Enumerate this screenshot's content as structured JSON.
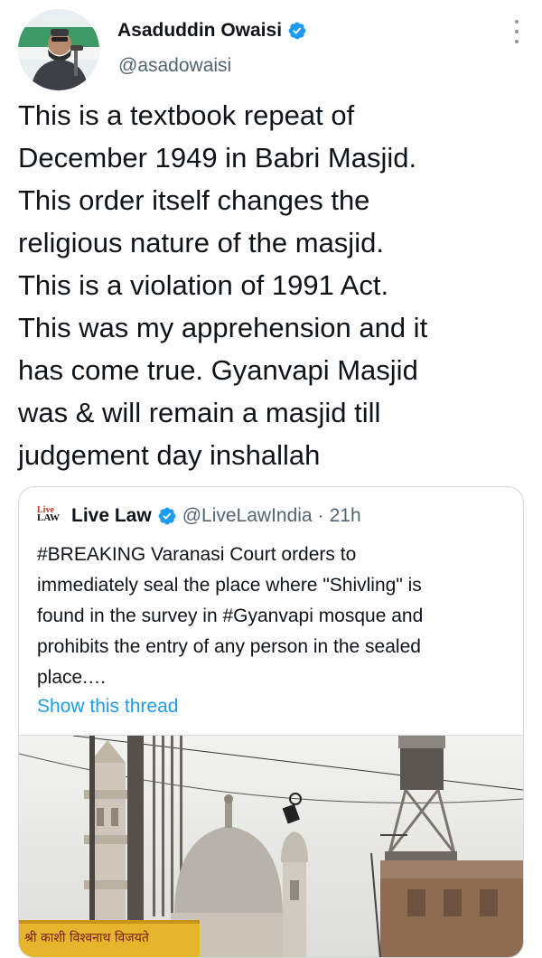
{
  "author": {
    "name": "Asaduddin Owaisi",
    "handle": "@asadowaisi",
    "verified": true,
    "avatar_icon": "avatar-photo"
  },
  "tweet": {
    "lines": [
      "This is a textbook repeat of",
      "December 1949 in Babri Masjid.",
      "This order itself changes the",
      "religious nature of the masjid.",
      "This is a violation of 1991 Act.",
      "This was my apprehension and it",
      "has come true. Gyanvapi Masjid",
      "was & will remain a masjid till",
      "judgement day inshallah"
    ]
  },
  "quote": {
    "logo_top": "Live",
    "logo_bottom": "LAW",
    "name": "Live Law",
    "verified": true,
    "handle": "@LiveLawIndia",
    "separator": "·",
    "time": "21h",
    "text_lines": [
      "#BREAKING Varanasi Court orders to",
      "immediately seal the place where \"Shivling\" is",
      "found in the survey in #Gyanvapi mosque and",
      "prohibits the entry of any person in the sealed",
      "place.…"
    ],
    "thread_link": "Show this thread",
    "image_sign_text": "श्री काशी विश्वनाथ विजयते"
  },
  "colors": {
    "text": "#0f1419",
    "secondary": "#536471",
    "link": "#1d9bf0",
    "verified_badge": "#1d9bf0",
    "border": "#cfd9de"
  }
}
